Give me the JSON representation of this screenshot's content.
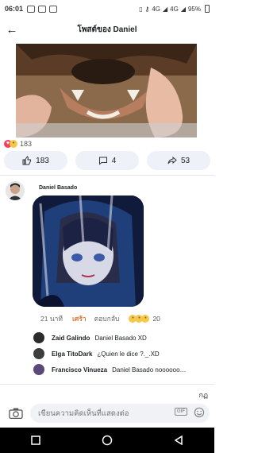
{
  "status_bar": {
    "time": "06:01",
    "network_label_1": "4G",
    "network_label_2": "4G",
    "battery_text": "95%"
  },
  "header": {
    "title": "โพสต์ของ Daniel"
  },
  "post": {
    "reaction_count": "183",
    "actions": {
      "like_count": "183",
      "comment_count": "4",
      "share_count": "53"
    }
  },
  "main_comment": {
    "author": "Daniel Basado",
    "time_ago": "21 นาที",
    "like_label": "เศร้า",
    "reply_label": "ตอบกลับ",
    "reaction_count": "20"
  },
  "replies": [
    {
      "name": "Zaid Galindo",
      "text": "Daniel Basado XD"
    },
    {
      "name": "Elga TitoDark",
      "text": "¿Quien le dice ?._.XD"
    },
    {
      "name": "Francisco Vinueza",
      "text": "Daniel Basado noooooo…"
    }
  ],
  "see_older_label": "กฏ",
  "composer": {
    "placeholder": "เขียนความคิดเห็นที่แสดงต่อ",
    "gif_label": "GIF"
  },
  "colors": {
    "like_orange": "#e0793a",
    "love_red": "#f23e5c",
    "haha_yellow": "#f7c748",
    "button_bg": "#eef2f8"
  }
}
